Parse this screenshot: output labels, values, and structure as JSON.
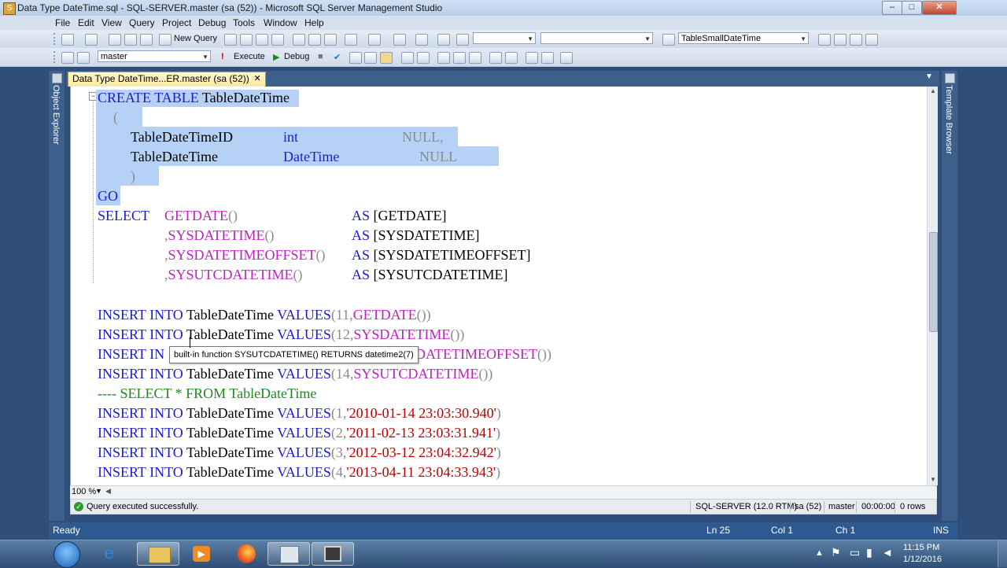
{
  "window": {
    "title": "Data Type DateTime.sql - SQL-SERVER.master (sa (52)) - Microsoft SQL Server Management Studio",
    "min": "–",
    "max": "□",
    "close": "✕"
  },
  "menu": [
    "File",
    "Edit",
    "View",
    "Query",
    "Project",
    "Debug",
    "Tools",
    "Window",
    "Help"
  ],
  "toolbar1": {
    "new_query": "New Query",
    "combo_left": "",
    "combo_mid": "",
    "combo_right": "TableSmallDateTime"
  },
  "toolbar2": {
    "database": "master",
    "execute": "Execute",
    "debug": "Debug"
  },
  "sidebars": {
    "left": "Object Explorer",
    "right": "Template Browser"
  },
  "tab": {
    "label": "Data Type DateTime...ER.master (sa (52))",
    "close": "✕"
  },
  "code": {
    "l1_kw": "CREATE TABLE",
    "l1_name": " TableDateTime",
    "l2": "(",
    "l3_col": "TableDateTimeID",
    "l3_type": "int",
    "l3_null": "NULL,",
    "l4_col": "TableDateTime",
    "l4_type": "DateTime",
    "l4_null": "NULL",
    "l5": ")",
    "l6": "GO",
    "l7_kw": "SELECT",
    "l7_fn": "GETDATE",
    "l7_paren": "()",
    "l7_as": "AS",
    "l7_alias": " [GETDATE]",
    "l8_comma": ",",
    "l8_fn": "SYSDATETIME",
    "l8_paren": "()",
    "l8_as": "AS",
    "l8_alias": " [SYSDATETIME]",
    "l9_comma": ",",
    "l9_fn": "SYSDATETIMEOFFSET",
    "l9_paren": "()",
    "l9_as": "AS",
    "l9_alias": " [SYSDATETIMEOFFSET]",
    "l10_comma": ",",
    "l10_fn": "SYSUTCDATETIME",
    "l10_paren": "()",
    "l10_as": "AS",
    "l10_alias": " [SYSUTCDATETIME]",
    "insert_kw": "INSERT INTO",
    "insert_tbl": " TableDateTime ",
    "values_kw": "VALUES",
    "i1_num": "(11,",
    "i1_fn": "GETDATE",
    "i1_end": "())",
    "i2_num": "(12,",
    "i2_fn": "SYSDATETIME",
    "i2_end": "())",
    "i3_start": "INSERT IN",
    "i3_fn": "SDATETIMEOFFSET",
    "i3_end": "())",
    "i4_num": "(14,",
    "i4_fn": "SYSUTCDATETIME",
    "i4_end": "())",
    "comment": "---- SELECT * FROM TableDateTime",
    "v1_num": "(1,",
    "v1_str": "'2010-01-14 23:03:30.940'",
    "v1_end": ")",
    "v2_num": "(2,",
    "v2_str": "'2011-02-13 23:03:31.941'",
    "v2_end": ")",
    "v3_num": "(3,",
    "v3_str": "'2012-03-12 23:04:32.942'",
    "v3_end": ")",
    "v4_num": "(4,",
    "v4_str": "'2013-04-11 23:04:33.943'",
    "v4_end": ")"
  },
  "tooltip": "built-in function SYSUTCDATETIME() RETURNS datetime2(7)",
  "zoom": "100 %",
  "query_status": {
    "message": "Query executed successfully.",
    "server": "SQL-SERVER (12.0 RTM)",
    "user": "sa (52)",
    "db": "master",
    "time": "00:00:00",
    "rows": "0 rows"
  },
  "status": {
    "ready": "Ready",
    "ln": "Ln 25",
    "col": "Col 1",
    "ch": "Ch 1",
    "ins": "INS"
  },
  "taskbar": {
    "time": "11:15 PM",
    "date": "1/12/2016"
  },
  "colors": {
    "keyword": "#1b1bd1",
    "function": "#c020c0",
    "string": "#c00000",
    "comment": "#1e8a1e",
    "selection": "#b5d2f6"
  }
}
